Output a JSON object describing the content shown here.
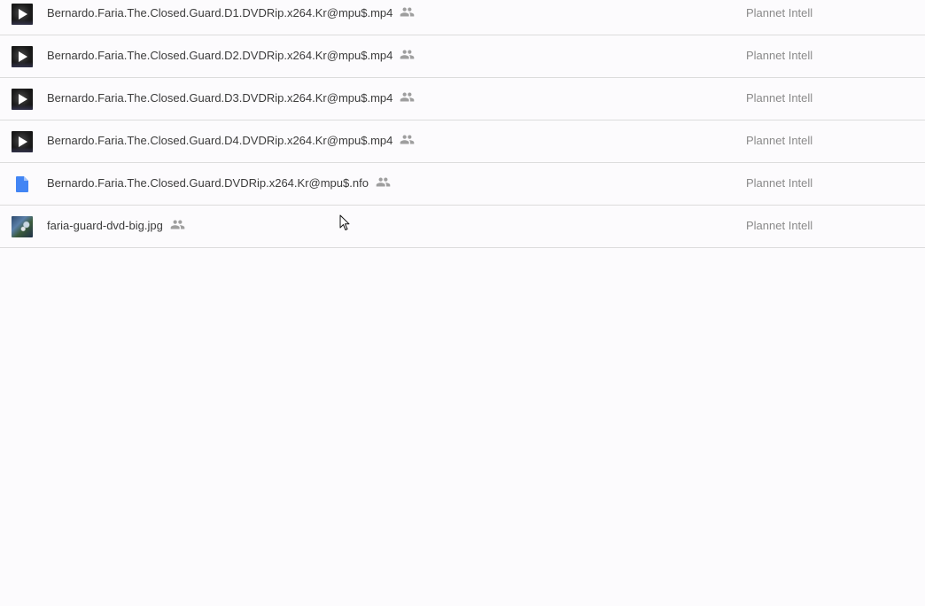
{
  "files": [
    {
      "name": "Bernardo.Faria.The.Closed.Guard.D1.DVDRip.x264.Kr@mpu$.mp4",
      "type": "video",
      "owner": "Plannet Intell",
      "icon": "video-thumbnail-icon",
      "shared_icon": "people-icon"
    },
    {
      "name": "Bernardo.Faria.The.Closed.Guard.D2.DVDRip.x264.Kr@mpu$.mp4",
      "type": "video",
      "owner": "Plannet Intell",
      "icon": "video-thumbnail-icon",
      "shared_icon": "people-icon"
    },
    {
      "name": "Bernardo.Faria.The.Closed.Guard.D3.DVDRip.x264.Kr@mpu$.mp4",
      "type": "video",
      "owner": "Plannet Intell",
      "icon": "video-thumbnail-icon",
      "shared_icon": "people-icon"
    },
    {
      "name": "Bernardo.Faria.The.Closed.Guard.D4.DVDRip.x264.Kr@mpu$.mp4",
      "type": "video",
      "owner": "Plannet Intell",
      "icon": "video-thumbnail-icon",
      "shared_icon": "people-icon"
    },
    {
      "name": "Bernardo.Faria.The.Closed.Guard.DVDRip.x264.Kr@mpu$.nfo",
      "type": "document",
      "owner": "Plannet Intell",
      "icon": "document-icon",
      "shared_icon": "people-icon"
    },
    {
      "name": "faria-guard-dvd-big.jpg",
      "type": "image",
      "owner": "Plannet Intell",
      "icon": "image-thumbnail-icon",
      "shared_icon": "people-icon"
    }
  ],
  "colors": {
    "background": "#fcfbfd",
    "divider": "#dcdcdc",
    "doc_icon_blue": "#4285f4",
    "shared_icon_gray": "#9e9e9e",
    "owner_text": "#8a8a8a",
    "name_text": "#3c3c3c"
  }
}
